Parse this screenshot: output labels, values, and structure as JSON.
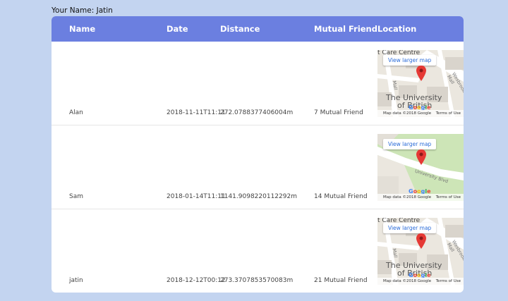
{
  "user": {
    "label": "Your Name: ",
    "name": "Jatin"
  },
  "table": {
    "headers": [
      "Name",
      "Date",
      "Distance",
      "Mutual Friend",
      "Location"
    ],
    "rows": [
      {
        "name": "Alan",
        "date": "2018-11-11T11:11",
        "distance": "272.0788377406004m",
        "mutual": "7 Mutual Friend",
        "map": {
          "button": "View larger map",
          "top_text": "t Care Centre",
          "title_line1": "The University",
          "title_line2": "of British",
          "street_a": "Wesbrook Mall",
          "street_b": "Mall",
          "footer_data": "Map data ©2018 Google",
          "footer_terms": "Terms of Use",
          "google": "Google"
        }
      },
      {
        "name": "Sam",
        "date": "2018-01-14T11:11",
        "distance": "1141.9098220112292m",
        "mutual": "14 Mutual Friend",
        "map": {
          "button": "View larger map",
          "street_a": "University Blvd",
          "footer_data": "Map data ©2018 Google",
          "footer_terms": "Terms of Use",
          "google": "Google"
        }
      },
      {
        "name": "jatin",
        "date": "2018-12-12T00:12",
        "distance": "273.3707853570083m",
        "mutual": "21 Mutual Friend",
        "map": {
          "button": "View larger map",
          "top_text": "t Care Centre",
          "title_line1": "The University",
          "title_line2": "of British",
          "street_a": "Wesbrook Mall",
          "street_b": "Mall",
          "footer_data": "Map data ©2018 Google",
          "footer_terms": "Terms of Use",
          "google": "Google"
        }
      }
    ]
  },
  "colors": {
    "background": "#c3d4f0",
    "header": "#6b7fe0",
    "pin": "#e53935"
  }
}
